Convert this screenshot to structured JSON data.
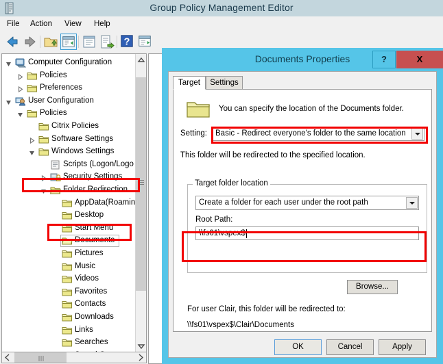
{
  "window": {
    "title": "Group Policy Management Editor",
    "sysicon": "console-icon",
    "menus": [
      {
        "label": "File"
      },
      {
        "label": "Action"
      },
      {
        "label": "View"
      },
      {
        "label": "Help"
      }
    ],
    "toolbar": [
      {
        "name": "back-icon",
        "label": "Back"
      },
      {
        "name": "forward-icon",
        "label": "Forward"
      },
      {
        "name": "up-one-level-icon",
        "label": "Up One Level"
      },
      {
        "name": "show-hide-tree-icon",
        "label": "Show/Hide Console Tree",
        "selected": true
      },
      {
        "name": "properties-icon",
        "label": "Properties"
      },
      {
        "name": "export-list-icon",
        "label": "Export List"
      },
      {
        "name": "help-icon",
        "label": "Help"
      },
      {
        "name": "show-filter-icon",
        "label": "Show Filter Options"
      }
    ]
  },
  "tree": {
    "nodes": [
      {
        "label": "Computer Configuration",
        "indent": 0,
        "expander": "expanded",
        "icon": "computer-icon"
      },
      {
        "label": "Policies",
        "indent": 1,
        "expander": "collapsed",
        "icon": "folder-icon"
      },
      {
        "label": "Preferences",
        "indent": 1,
        "expander": "collapsed",
        "icon": "folder-icon"
      },
      {
        "label": "User Configuration",
        "indent": 0,
        "expander": "expanded",
        "icon": "user-icon"
      },
      {
        "label": "Policies",
        "indent": 1,
        "expander": "expanded",
        "icon": "folder-icon"
      },
      {
        "label": "Citrix Policies",
        "indent": 2,
        "expander": "none",
        "icon": "folder-icon"
      },
      {
        "label": "Software Settings",
        "indent": 2,
        "expander": "collapsed",
        "icon": "folder-icon"
      },
      {
        "label": "Windows Settings",
        "indent": 2,
        "expander": "expanded",
        "icon": "folder-icon"
      },
      {
        "label": "Scripts (Logon/Logo",
        "indent": 3,
        "expander": "none",
        "icon": "scripts-icon"
      },
      {
        "label": "Security Settings",
        "indent": 3,
        "expander": "collapsed",
        "icon": "security-icon"
      },
      {
        "label": "Folder Redirection",
        "indent": 3,
        "expander": "expanded",
        "icon": "folder-open-icon",
        "highlighted": true
      },
      {
        "label": "AppData(Roamin",
        "indent": 4,
        "expander": "none",
        "icon": "folder-icon"
      },
      {
        "label": "Desktop",
        "indent": 4,
        "expander": "none",
        "icon": "folder-icon"
      },
      {
        "label": "Start Menu",
        "indent": 4,
        "expander": "none",
        "icon": "folder-icon"
      },
      {
        "label": "Documents",
        "indent": 4,
        "expander": "none",
        "icon": "folder-open-icon",
        "selected": true,
        "highlighted": true
      },
      {
        "label": "Pictures",
        "indent": 4,
        "expander": "none",
        "icon": "folder-icon"
      },
      {
        "label": "Music",
        "indent": 4,
        "expander": "none",
        "icon": "folder-icon"
      },
      {
        "label": "Videos",
        "indent": 4,
        "expander": "none",
        "icon": "folder-icon"
      },
      {
        "label": "Favorites",
        "indent": 4,
        "expander": "none",
        "icon": "folder-icon"
      },
      {
        "label": "Contacts",
        "indent": 4,
        "expander": "none",
        "icon": "folder-icon"
      },
      {
        "label": "Downloads",
        "indent": 4,
        "expander": "none",
        "icon": "folder-icon"
      },
      {
        "label": "Links",
        "indent": 4,
        "expander": "none",
        "icon": "folder-icon"
      },
      {
        "label": "Searches",
        "indent": 4,
        "expander": "none",
        "icon": "folder-icon"
      },
      {
        "label": "Saved Games",
        "indent": 4,
        "expander": "none",
        "icon": "folder-icon"
      }
    ]
  },
  "dialog": {
    "title": "Documents Properties",
    "help_label": "?",
    "close_label": "X",
    "tabs": [
      {
        "label": "Target",
        "active": true
      },
      {
        "label": "Settings",
        "active": false
      }
    ],
    "description": "You can specify the location of the Documents folder.",
    "setting_label": "Setting:",
    "setting_value": "Basic - Redirect everyone's folder to the same location",
    "setting_note": "This folder will be redirected to the specified location.",
    "group_title": "Target folder location",
    "target_location_value": "Create a folder for each user under the root path",
    "root_path_label": "Root Path:",
    "root_path_value": "\\\\fs01\\vspex$",
    "browse_label": "Browse...",
    "preview_line1": "For user Clair, this folder will be redirected to:",
    "preview_line2": "\\\\fs01\\vspex$\\Clair\\Documents",
    "buttons": {
      "ok": "OK",
      "cancel": "Cancel",
      "apply": "Apply"
    }
  },
  "annotations": {
    "color": "#f20000",
    "boxes": [
      {
        "name": "highlight-folder-redirection"
      },
      {
        "name": "highlight-documents"
      },
      {
        "name": "highlight-setting-combo"
      },
      {
        "name": "highlight-root-path"
      }
    ]
  }
}
